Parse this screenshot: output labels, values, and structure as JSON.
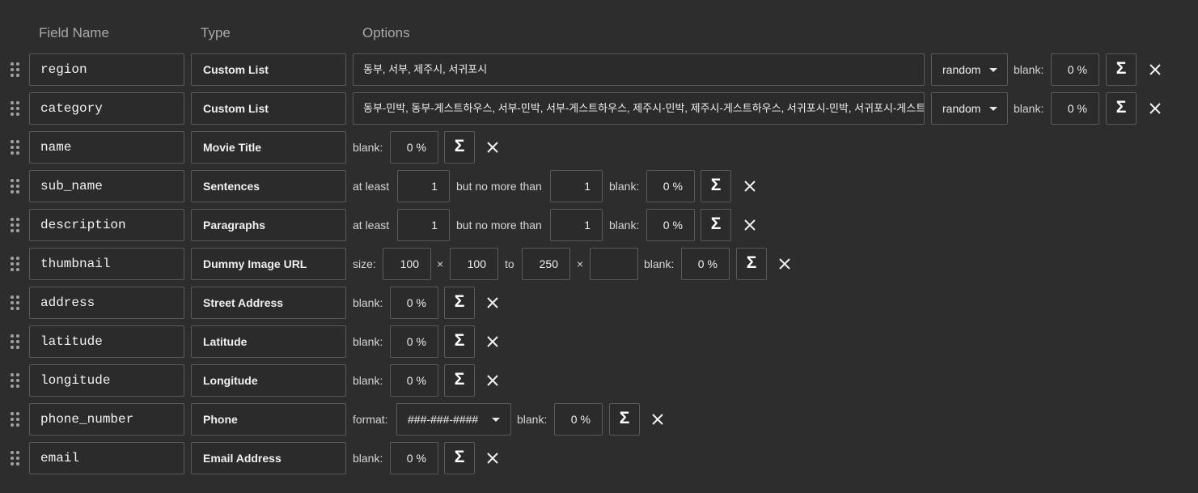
{
  "headers": {
    "field_name": "Field Name",
    "type": "Type",
    "options": "Options"
  },
  "labels": {
    "blank": "blank:",
    "percent": "%",
    "at_least": "at least",
    "but_no_more_than": "but no more than",
    "size": "size:",
    "times": "×",
    "to": "to",
    "format": "format:",
    "sigma": "Σ"
  },
  "rows": [
    {
      "name": "region",
      "type": "Custom List",
      "options_text": "동부, 서부, 제주시, 서귀포시",
      "mode": "random",
      "blank": "0"
    },
    {
      "name": "category",
      "type": "Custom List",
      "options_text": "동부-민박, 동부-게스트하우스, 서부-민박, 서부-게스트하우스, 제주시-민박, 제주시-게스트하우스, 서귀포시-민박, 서귀포시-게스트하우스",
      "mode": "random",
      "blank": "0"
    },
    {
      "name": "name",
      "type": "Movie Title",
      "blank": "0"
    },
    {
      "name": "sub_name",
      "type": "Sentences",
      "at_least": "1",
      "no_more_than": "1",
      "blank": "0"
    },
    {
      "name": "description",
      "type": "Paragraphs",
      "at_least": "1",
      "no_more_than": "1",
      "blank": "0"
    },
    {
      "name": "thumbnail",
      "type": "Dummy Image URL",
      "size_w": "100",
      "size_h": "100",
      "to_w": "250",
      "to_h": "",
      "blank": "0"
    },
    {
      "name": "address",
      "type": "Street Address",
      "blank": "0"
    },
    {
      "name": "latitude",
      "type": "Latitude",
      "blank": "0"
    },
    {
      "name": "longitude",
      "type": "Longitude",
      "blank": "0"
    },
    {
      "name": "phone_number",
      "type": "Phone",
      "format": "###-###-####",
      "blank": "0"
    },
    {
      "name": "email",
      "type": "Email Address",
      "blank": "0"
    }
  ],
  "icons": {
    "drag": "drag-handle-icon",
    "sort": "up-down-chevron-icon",
    "caret": "caret-down-icon",
    "sum": "sigma-icon",
    "remove": "close-icon"
  }
}
